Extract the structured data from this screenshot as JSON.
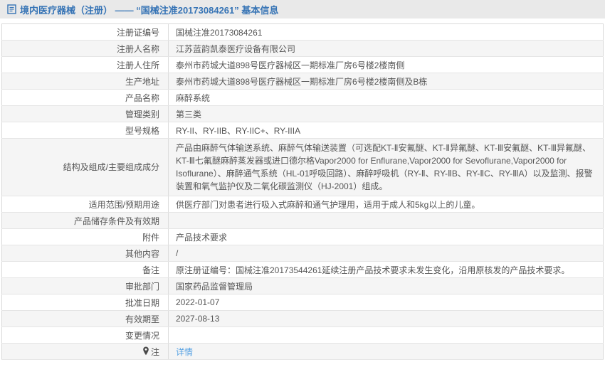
{
  "header": {
    "title": "境内医疗器械（注册） —— “国械注准20173084261” 基本信息",
    "icon": "document-icon"
  },
  "colors": {
    "title_blue": "#3573b5",
    "link_blue": "#55a1e3",
    "header_bg": "#e9e9e9",
    "alt_row_bg": "#f5f5f5",
    "border": "#d9d9d9",
    "text": "#555555"
  },
  "table": {
    "rows": [
      {
        "label": "注册证编号",
        "value": "国械注准20173084261"
      },
      {
        "label": "注册人名称",
        "value": "江苏蓝韵凯泰医疗设备有限公司"
      },
      {
        "label": "注册人住所",
        "value": "泰州市药城大道898号医疗器械区一期标准厂房6号楼2楼南侧"
      },
      {
        "label": "生产地址",
        "value": "泰州市药城大道898号医疗器械区一期标准厂房6号楼2楼南侧及B栋"
      },
      {
        "label": "产品名称",
        "value": "麻醉系统"
      },
      {
        "label": "管理类别",
        "value": "第三类"
      },
      {
        "label": "型号规格",
        "value": "RY-II、RY-IIB、RY-IIC+、RY-IIIA"
      },
      {
        "label": "结构及组成/主要组成成分",
        "value": "产品由麻醉气体输送系统、麻醉气体输送装置（可选配KT-Ⅱ安氟醚、KT-Ⅱ异氟醚、KT-Ⅲ安氟醚、KT-Ⅲ异氟醚、KT-Ⅲ七氟醚麻醉蒸发器或进口德尔格Vapor2000 for Enflurane,Vapor2000 for Sevoflurane,Vapor2000 for Isoflurane）、麻醉通气系统（HL-01呼吸回路）、麻醉呼吸机（RY-Ⅱ、RY-ⅡB、RY-ⅡC、RY-ⅢA）以及监测、报警装置和氧气监护仪及二氧化碳监测仪（HJ-2001）组成。",
        "tall": true
      },
      {
        "label": "适用范围/预期用途",
        "value": "供医疗部门对患者进行吸入式麻醉和通气护理用，适用于成人和5kg以上的儿童。"
      },
      {
        "label": "产品储存条件及有效期",
        "value": ""
      },
      {
        "label": "附件",
        "value": "产品技术要求"
      },
      {
        "label": "其他内容",
        "value": "/"
      },
      {
        "label": "备注",
        "value": "原注册证编号：国械注准20173544261延续注册产品技术要求未发生变化，沿用原核发的产品技术要求。"
      },
      {
        "label": "审批部门",
        "value": "国家药品监督管理局"
      },
      {
        "label": "批准日期",
        "value": "2022-01-07"
      },
      {
        "label": "有效期至",
        "value": "2027-08-13"
      },
      {
        "label": "变更情况",
        "value": ""
      },
      {
        "label": "注",
        "value": "详情",
        "link": true,
        "icon": "pin-icon"
      }
    ]
  }
}
